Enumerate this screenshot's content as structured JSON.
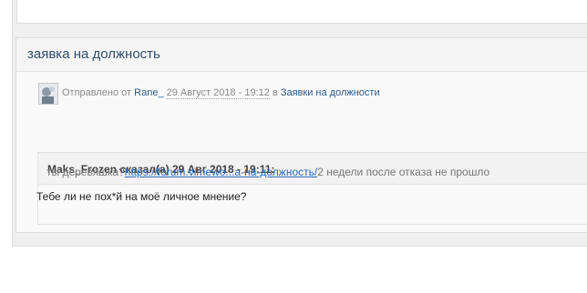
{
  "topic": {
    "title": "заявка на должность"
  },
  "post": {
    "sent_by_label": "Отправлено от",
    "author": "Rane_",
    "date": "29 Август 2018 - 19:12",
    "in_label": "в",
    "forum": "Заявки на должности",
    "quote": {
      "header": "Maks_Frozen сказал(а) 29 Авг 2018 - 19:11:",
      "text_before": "ты деревяшка?",
      "link": "https://forum.vimewo...а-на-должность/",
      "text_after": "2 недели после отказа не прошло"
    },
    "reply": "Тебе ли не пох*й на моё личное мнение?"
  }
}
